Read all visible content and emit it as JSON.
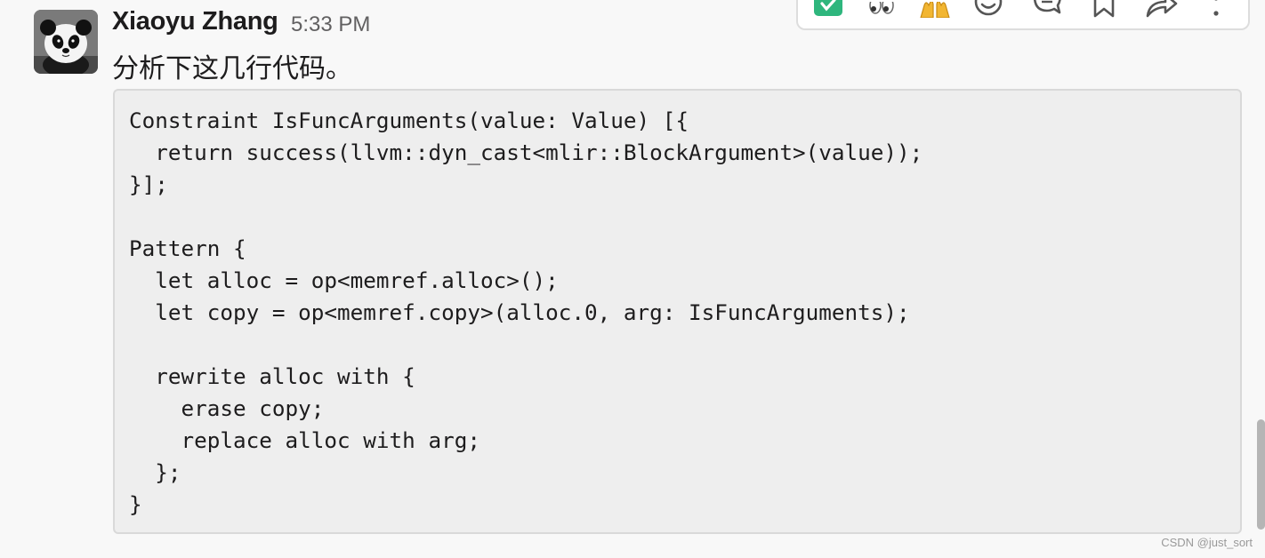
{
  "message": {
    "sender": "Xiaoyu Zhang",
    "time": "5:33 PM",
    "text": "分析下这几行代码。",
    "avatar_icon": "panda-avatar",
    "code": "Constraint IsFuncArguments(value: Value) [{\n  return success(llvm::dyn_cast<mlir::BlockArgument>(value));\n}];\n\nPattern {\n  let alloc = op<memref.alloc>();\n  let copy = op<memref.copy>(alloc.0, arg: IsFuncArguments);\n\n  rewrite alloc with {\n    erase copy;\n    replace alloc with arg;\n  };\n}"
  },
  "toolbar": {
    "items": [
      {
        "icon": "checkmark-reaction-icon",
        "action": "react with check mark"
      },
      {
        "icon": "eyes-reaction-icon",
        "action": "react with eyes"
      },
      {
        "icon": "raised-hands-reaction-icon",
        "action": "react with raised hands"
      },
      {
        "icon": "add-reaction-icon",
        "action": "add reaction"
      },
      {
        "icon": "reply-in-thread-icon",
        "action": "reply in thread"
      },
      {
        "icon": "bookmark-icon",
        "action": "save for later"
      },
      {
        "icon": "share-icon",
        "action": "share message"
      },
      {
        "icon": "more-actions-icon",
        "action": "more actions"
      }
    ],
    "accent_color": "#2eb67d"
  },
  "watermark": "CSDN @just_sort"
}
